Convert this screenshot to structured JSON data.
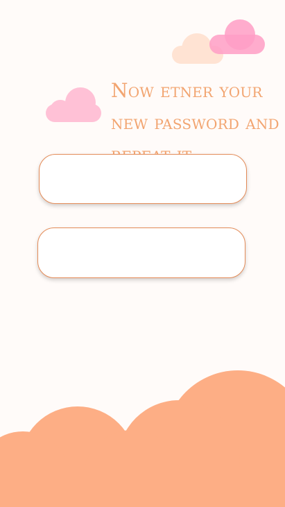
{
  "screen": {
    "background_color": "#fffbf9",
    "accent_color": "#f2a571",
    "field_border_color": "#e48b57",
    "hill_color": "#fdae85",
    "cloud_pink": "#ffc1d6",
    "cloud_pink_strong": "#ff9ec5",
    "cloud_peach": "#ffe3d3"
  },
  "prompt": {
    "text": "Now etner your new password and repeat it."
  },
  "form": {
    "new_password": {
      "value": "",
      "placeholder": ""
    },
    "repeat_password": {
      "value": "",
      "placeholder": ""
    }
  }
}
